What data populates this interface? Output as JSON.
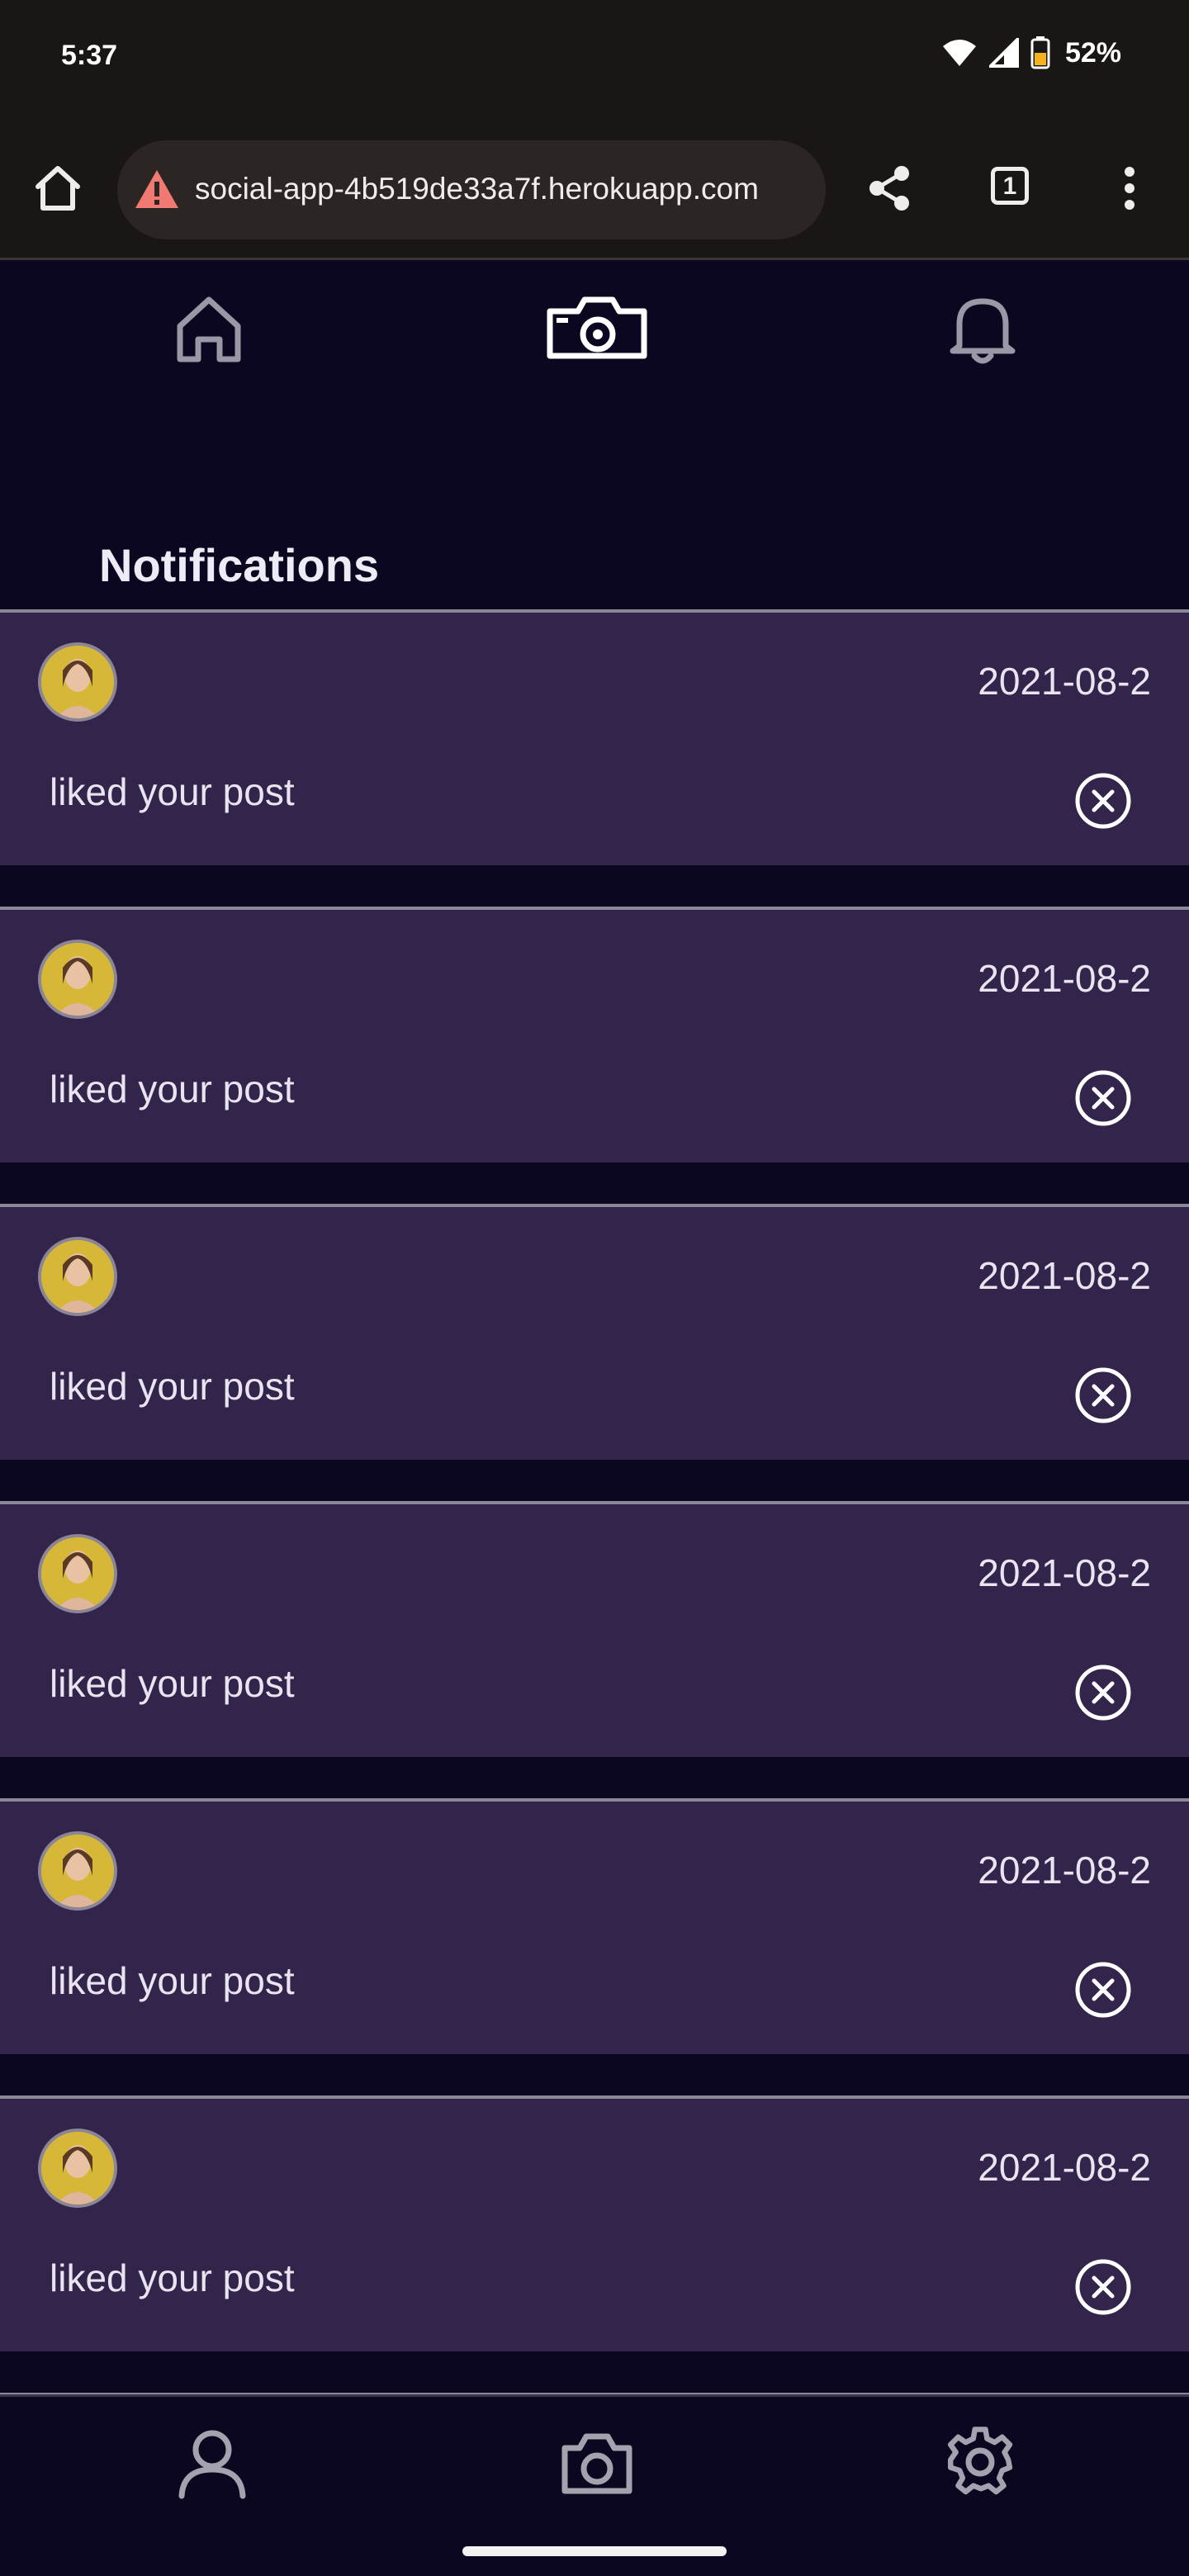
{
  "status_bar": {
    "time": "5:37",
    "battery": "52%",
    "icons": [
      "wifi-icon",
      "signal-icon",
      "battery-icon"
    ]
  },
  "browser": {
    "url": "social-app-4b519de33a7f.herokuapp.com",
    "tab_count": "1",
    "icons": [
      "home-icon",
      "warning-icon",
      "share-icon",
      "tabs-icon",
      "menu-icon"
    ]
  },
  "top_nav": {
    "items": [
      {
        "name": "home",
        "icon": "home-icon"
      },
      {
        "name": "camera",
        "icon": "camera-icon"
      },
      {
        "name": "notifications",
        "icon": "bell-icon"
      }
    ]
  },
  "page": {
    "title": "Notifications"
  },
  "notifications": [
    {
      "date": "2021-08-2",
      "text": "liked your post"
    },
    {
      "date": "2021-08-2",
      "text": "liked your post"
    },
    {
      "date": "2021-08-2",
      "text": "liked your post"
    },
    {
      "date": "2021-08-2",
      "text": "liked your post"
    },
    {
      "date": "2021-08-2",
      "text": "liked your post"
    },
    {
      "date": "2021-08-2",
      "text": "liked your post"
    }
  ],
  "bottom_nav": {
    "items": [
      {
        "name": "profile",
        "icon": "user-icon"
      },
      {
        "name": "camera",
        "icon": "camera-icon"
      },
      {
        "name": "settings",
        "icon": "gear-icon"
      }
    ]
  },
  "colors": {
    "background": "#0c0720",
    "card": "#33244b",
    "card_border": "#8c8798",
    "text": "#e8e4f0",
    "chrome": "#1a1614"
  }
}
